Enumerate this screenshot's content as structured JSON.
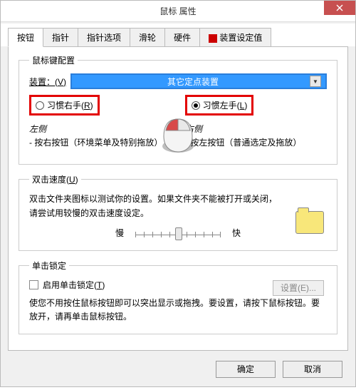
{
  "window": {
    "title": "鼠标 属性"
  },
  "tabs": [
    "按钮",
    "指针",
    "指针选项",
    "滑轮",
    "硬件",
    "装置设定值"
  ],
  "buttons_group": {
    "legend": "鼠标键配置",
    "device_label": "装置：(",
    "device_label_key": "V",
    "device_label_end": ")",
    "dropdown_value": "其它定点装置",
    "radio_right": "习惯右手(",
    "radio_right_key": "R",
    "radio_right_end": ")",
    "radio_left": "习惯左手(",
    "radio_left_key": "L",
    "radio_left_end": ")",
    "left": {
      "title": "左侧",
      "desc": "- 按右按钮（环境菜单及特别拖放）"
    },
    "right": {
      "title": "右侧",
      "desc": "- 按左按钮（普通选定及拖放）"
    }
  },
  "dbl": {
    "legend": "双击速度(",
    "legend_key": "U",
    "legend_end": ")",
    "text": "双击文件夹图标以测试你的设置。如果文件夹不能被打开或关闭，请尝试用较慢的双击速度设定。",
    "slow": "慢",
    "fast": "快"
  },
  "lock": {
    "legend": "单击锁定",
    "enable": "启用单击锁定(",
    "enable_key": "T",
    "enable_end": ")",
    "settings_btn": "设置(E)...",
    "text": "使您不用按住鼠标按钮即可以突出显示或拖拽。要设置，请按下鼠标按钮。要放开，请再单击鼠标按钮。"
  },
  "footer": {
    "ok": "确定",
    "cancel": "取消"
  }
}
